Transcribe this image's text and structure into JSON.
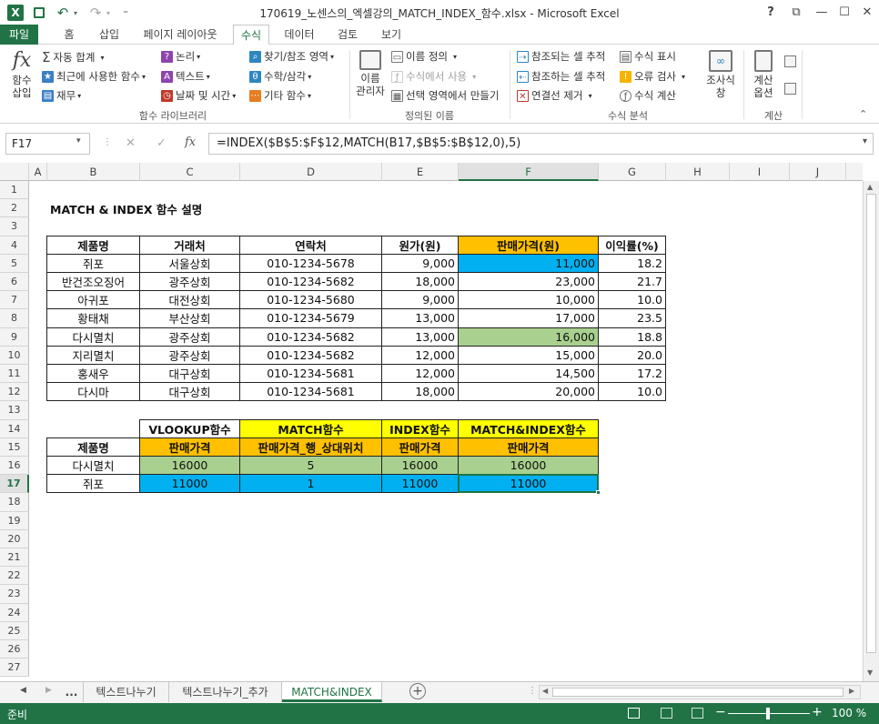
{
  "window": {
    "title": "170619_노센스의_엑셀강의_MATCH_INDEX_함수.xlsx - Microsoft Excel",
    "help": "?",
    "restore": "⧉",
    "minimize": "—",
    "maximize": "☐",
    "close": "✕"
  },
  "quick_access": {
    "undo": "↶",
    "redo": "↷",
    "customize": "⁼"
  },
  "tabs": [
    "파일",
    "홈",
    "삽입",
    "페이지 레이아웃",
    "수식",
    "데이터",
    "검토",
    "보기"
  ],
  "ribbon": {
    "insert_function": [
      "함수",
      "삽입"
    ],
    "autosum": "자동 합계",
    "recent": "최근에 사용한 함수",
    "finance": "재무",
    "logic": "논리",
    "text": "텍스트",
    "datetime": "날짜 및 시간",
    "lookup": "찾기/참조 영역",
    "math": "수학/삼각",
    "more": "기타 함수",
    "group_library": "함수 라이브러리",
    "name_manager": [
      "이름",
      "관리자"
    ],
    "define_name": "이름 정의",
    "use_in_formula": "수식에서 사용",
    "create_from_sel": "선택 영역에서 만들기",
    "group_names": "정의된 이름",
    "trace_precedents": "참조되는 셀 추적",
    "trace_dependents": "참조하는 셀 추적",
    "remove_arrows": "연결선 제거",
    "show_formulas": "수식 표시",
    "error_check": "오류 검사",
    "eval_formula": "수식 계산",
    "watch": [
      "조사식",
      "창"
    ],
    "group_audit": "수식 분석",
    "calc_options": [
      "계산",
      "옵션"
    ],
    "group_calc": "계산"
  },
  "formula_bar": {
    "name_box": "F17",
    "formula": "=INDEX($B$5:$F$12,MATCH(B17,$B$5:$B$12,0),5)",
    "cancel": "✕",
    "enter": "✓",
    "fx": "fx"
  },
  "columns": [
    "A",
    "B",
    "C",
    "D",
    "E",
    "F",
    "G",
    "H",
    "I",
    "J"
  ],
  "rows": [
    "1",
    "2",
    "3",
    "4",
    "5",
    "6",
    "7",
    "8",
    "9",
    "10",
    "11",
    "12",
    "13",
    "14",
    "15",
    "16",
    "17",
    "18",
    "19",
    "20",
    "21",
    "22",
    "23",
    "24",
    "25",
    "26",
    "27"
  ],
  "sheet": {
    "title": "MATCH & INDEX 함수 설명",
    "headers": [
      "제품명",
      "거래처",
      "연락처",
      "원가(원)",
      "판매가격(원)",
      "이익률(%)"
    ],
    "data": [
      [
        "쥐포",
        "서울상회",
        "010-1234-5678",
        "9,000",
        "11,000",
        "18.2"
      ],
      [
        "반건조오징어",
        "광주상회",
        "010-1234-5682",
        "18,000",
        "23,000",
        "21.7"
      ],
      [
        "아귀포",
        "대전상회",
        "010-1234-5680",
        "9,000",
        "10,000",
        "10.0"
      ],
      [
        "황태채",
        "부산상회",
        "010-1234-5679",
        "13,000",
        "17,000",
        "23.5"
      ],
      [
        "다시멸치",
        "광주상회",
        "010-1234-5682",
        "13,000",
        "16,000",
        "18.8"
      ],
      [
        "지리멸치",
        "광주상회",
        "010-1234-5682",
        "12,000",
        "15,000",
        "20.0"
      ],
      [
        "홍새우",
        "대구상회",
        "010-1234-5681",
        "12,000",
        "14,500",
        "17.2"
      ],
      [
        "다시마",
        "대구상회",
        "010-1234-5681",
        "18,000",
        "20,000",
        "10.0"
      ]
    ],
    "summary_top": [
      "VLOOKUP함수",
      "MATCH함수",
      "INDEX함수",
      "MATCH&INDEX함수"
    ],
    "summary_header": [
      "제품명",
      "판매가격",
      "판매가격_행_상대위치",
      "판매가격",
      "판매가격"
    ],
    "summary_rows": [
      [
        "다시멸치",
        "16000",
        "5",
        "16000",
        "16000"
      ],
      [
        "쥐포",
        "11000",
        "1",
        "11000",
        "11000"
      ]
    ]
  },
  "sheet_tabs": [
    "...",
    "텍스트나누기",
    "텍스트나누기_추가",
    "MATCH&INDEX"
  ],
  "status": {
    "ready": "준비",
    "zoom": "100 %"
  },
  "colors": {
    "green": "#217346",
    "orange": "#ffc000",
    "yellow": "#ffff00",
    "blue": "#00b0f0",
    "lightgreen": "#a9d08e"
  }
}
